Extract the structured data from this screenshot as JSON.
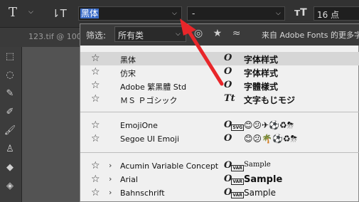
{
  "options_bar": {
    "font_family_value": "黑体",
    "font_style_value": "-",
    "font_size_value": "16 点"
  },
  "doc_tab": {
    "label": "123.tif @ 100"
  },
  "filter": {
    "label": "筛选:",
    "class_value": "所有类",
    "adobe_fonts_text": "来自 Adobe Fonts 的更多字"
  },
  "fonts": [
    {
      "name": "黑体",
      "sample": "字体样式",
      "type_icon": "opentype-icon",
      "expandable": false,
      "highlighted": true
    },
    {
      "name": "仿宋",
      "sample": "字体样式",
      "type_icon": "opentype-icon",
      "expandable": false,
      "highlighted": false
    },
    {
      "name": "Adobe 繁黑體 Std",
      "sample": "字體樣式",
      "type_icon": "opentype-icon",
      "expandable": false,
      "highlighted": false
    },
    {
      "name": "ＭＳ Ｐゴシック",
      "sample": "文字もじモジ",
      "type_icon": "truetype-icon",
      "expandable": false,
      "highlighted": false
    },
    {
      "name": "EmojiOne",
      "sample": "😊😕✈⚽♻⛈",
      "type_icon": "opentype-svg-icon",
      "expandable": false,
      "highlighted": false
    },
    {
      "name": "Segoe UI Emoji",
      "sample": "😊😕🌴⚽♻⛈",
      "type_icon": "opentype-icon",
      "expandable": false,
      "highlighted": false
    },
    {
      "name": "Acumin Variable Concept",
      "sample": "Sample",
      "type_icon": "opentype-variable-icon",
      "expandable": true,
      "highlighted": false
    },
    {
      "name": "Arial",
      "sample": "Sample",
      "type_icon": "opentype-variable-icon",
      "expandable": true,
      "highlighted": false
    },
    {
      "name": "Bahnschrift",
      "sample": "Sample",
      "type_icon": "opentype-variable-icon",
      "expandable": true,
      "highlighted": false
    }
  ],
  "colors": {
    "selection": "#3d6ec9",
    "arrow": "#e8262a",
    "panel": "#f0f0f0"
  }
}
